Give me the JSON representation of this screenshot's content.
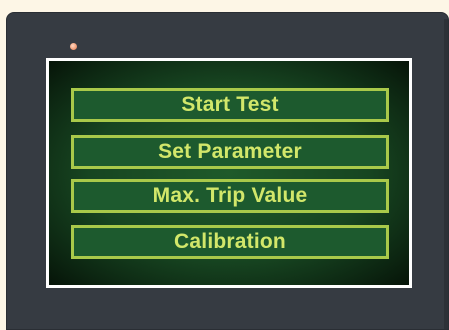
{
  "screen": {
    "menu": [
      {
        "label": "Start Test"
      },
      {
        "label": "Set Parameter"
      },
      {
        "label": "Max. Trip Value"
      },
      {
        "label": "Calibration"
      }
    ]
  },
  "colors": {
    "panel": "#363b42",
    "screen_bg": "#1d5a2e",
    "button_border": "#a9c94a",
    "button_text": "#d2e76a",
    "led": "#f3a27c"
  },
  "icons": {
    "indicator": "status-led-icon"
  }
}
